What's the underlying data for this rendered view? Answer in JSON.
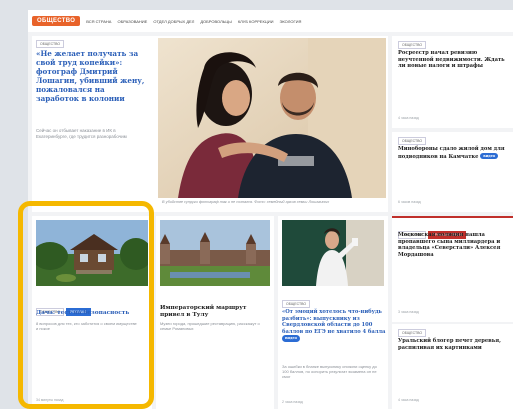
{
  "nav": {
    "brand": "ОБЩЕСТВО",
    "links": [
      "Вся страна",
      "Образование",
      "Отдел добрых дел",
      "Добровольцы",
      "Клуб коррекции",
      "Экология"
    ]
  },
  "featured": {
    "tag": "ОБЩЕСТВО",
    "headline": "«Не желает получать за свой труд копейки»: фотограф Дмитрий Лошагин, убивший жену, пожаловался на заработок в колонии",
    "summary": "Сейчас он отбывает наказание в ИК в Екатеринбурге, где трудится разнорабочим",
    "caption": "В убийстве супруги фотограф так и не сознался. Фото: семейный архив семьи Лошагиных",
    "date": ""
  },
  "side_top": {
    "tag": "ОБЩЕСТВО",
    "headline": "Росреестр начал ревизию неучтенной недвижимости. Ждать ли новые налоги и штрафы",
    "date": "4 часа назад"
  },
  "side_mid": {
    "tag": "ОБЩЕСТВО",
    "headline": "Минобороны сдало жилой дом для подводников на Камчатке",
    "pill": "видео",
    "date": "6 часов назад"
  },
  "card_dacha": {
    "tags": [
      "ОБЩЕСТВО",
      "РЕКЛАМА"
    ],
    "headline": "Дача: тест на безопасность",
    "summary": "8 вопросов для тех, кто заботится о своем имуществе и покое",
    "date": "34 минуты назад"
  },
  "card_tour": {
    "headline": "Император­ский маршрут привел в Тулу",
    "summary": "Музеи города, прошедшие реставрацию, расскажут о семье Романовых",
    "date": ""
  },
  "card_exam": {
    "tag": "ОБЩЕСТВО",
    "headline": "«От эмоций хотелось что-нибудь разбить»: выпускнику из Свердловской области до 100 баллов по ЕГЭ не хватило 4 балла",
    "pill": "видео",
    "summary": "За ошибки в бланке выпускнику снизили оценку до 100 баллов, но оспорить результат экзамена он не смог",
    "date": "2 часа назад"
  },
  "side_red": {
    "tags": [
      "ОБЩЕСТВО",
      "ПРОИСШЕСТВИЯ"
    ],
    "headline": "Московская полиция нашла пропавшего сына миллиардера и владельца «Северстали» Алексея Мордашова",
    "date": "3 часа назад"
  },
  "side_bottom": {
    "tag": "ОБЩЕСТВО",
    "headline": "Уральский блогер печет деревья, распиливая их картинками",
    "date": "4 часа назад"
  }
}
